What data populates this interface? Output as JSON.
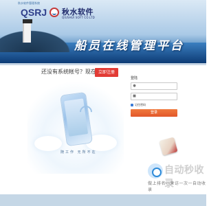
{
  "banner": {
    "subtitle_small": "秋水软件管理系统",
    "brand_code": "QSRJ",
    "company_cn": "秋水软件",
    "company_en": "QIUSHUI SOFT CO.LTD",
    "slogan": "船员在线管理平台"
  },
  "promo": {
    "text": "还没有系统帐号？现在加入",
    "register_label": "立即注册",
    "illustration_caption": "随工作  无所不在"
  },
  "login": {
    "title": "登陆",
    "username_placeholder": "",
    "password_placeholder": "",
    "remember_label": "记住密码",
    "submit_label": "登录"
  },
  "watermark": {
    "title": "自动秒收录",
    "subtitle": "做上排名一来访一次一自动收录"
  },
  "colors": {
    "register_button": "#e23b35",
    "login_button": "#e2572a",
    "banner_sea": "#0f3f7a"
  }
}
